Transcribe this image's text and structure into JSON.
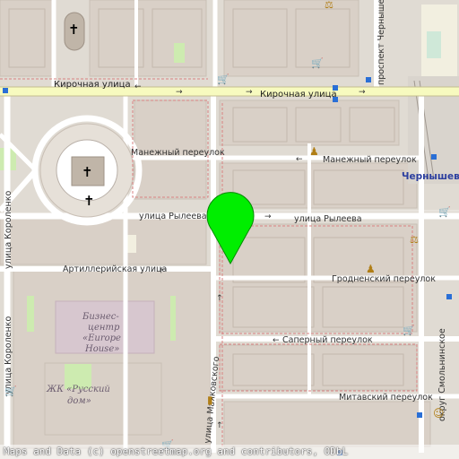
{
  "map": {
    "streets": {
      "kirochnaya_left": "Кирочная улица",
      "kirochnaya_right": "Кирочная улица",
      "manezhny_left": "Манежный переулок",
      "manezhny_right": "Манежный переулок",
      "ryleeva_left": "улица Рылеева",
      "ryleeva_right": "улица Рылеева",
      "artilleriyskaya": "Артиллерийская улица",
      "grodensky": "Гродненский переулок",
      "saperny": "Саперный переулок",
      "mitavsky": "Митавский переулок",
      "mayakovskogo": "улица Маяковского",
      "korolenko_top": "улица Короленко",
      "korolenko_bottom": "улица Короленко",
      "chernyshevskogo_prospect": "проспект Чернышевского",
      "okrug_smolninskoe": "округ Смольнинское"
    },
    "places": {
      "metro": "Чернышевск",
      "business_center_line1": "Бизнес-",
      "business_center_line2": "центр",
      "business_center_line3": "«Europe",
      "business_center_line4": "House»",
      "residential_line1": "ЖК «Русский",
      "residential_line2": "дом»"
    },
    "marker": {
      "color": "#00ee00",
      "type": "pin"
    },
    "attribution": "Maps and Data (c) openstreetmap.org and contributors, ODbL"
  }
}
